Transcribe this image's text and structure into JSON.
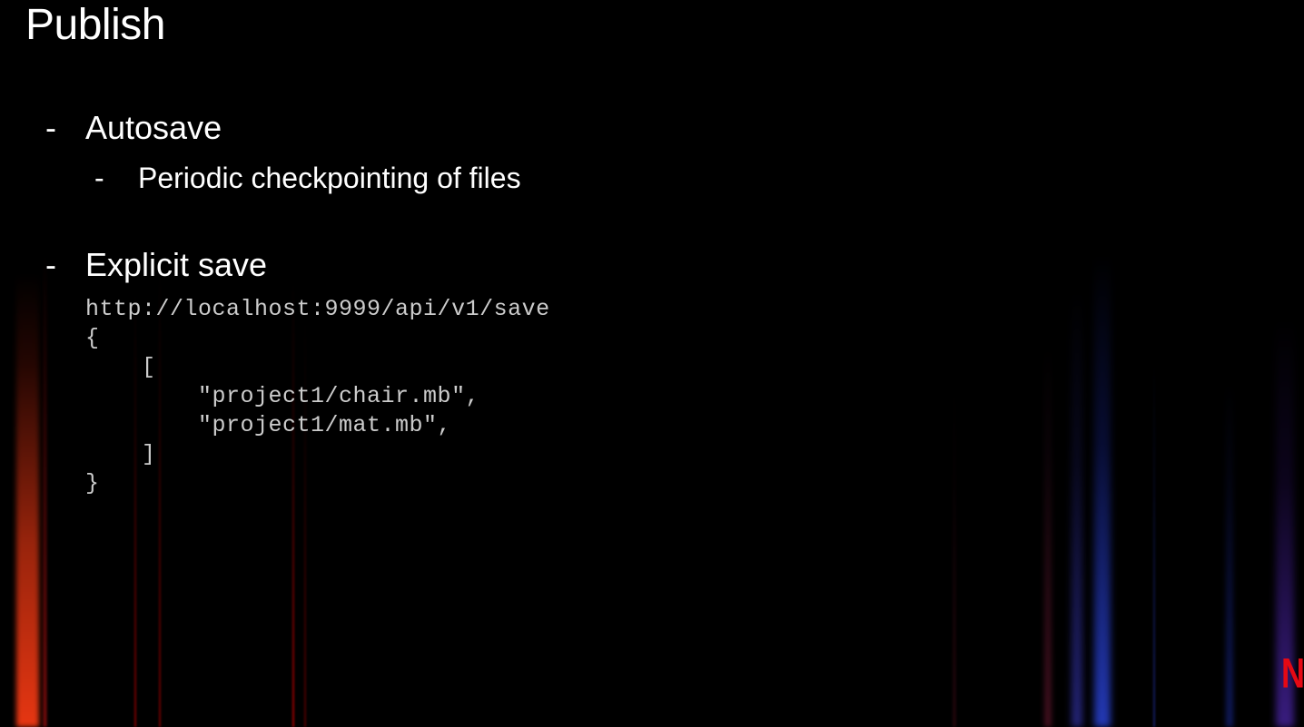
{
  "slide": {
    "title": "Publish",
    "bullets": [
      {
        "level": 1,
        "text": "Autosave",
        "children": [
          {
            "level": 2,
            "text": "Periodic checkpointing of files"
          }
        ]
      },
      {
        "level": 1,
        "text": "Explicit save",
        "code": "http://localhost:9999/api/v1/save\n{\n    [\n        \"project1/chair.mb\",\n        \"project1/mat.mb\",\n    ]\n}"
      }
    ]
  },
  "logo": {
    "text": "N",
    "name": "netflix-logo"
  }
}
